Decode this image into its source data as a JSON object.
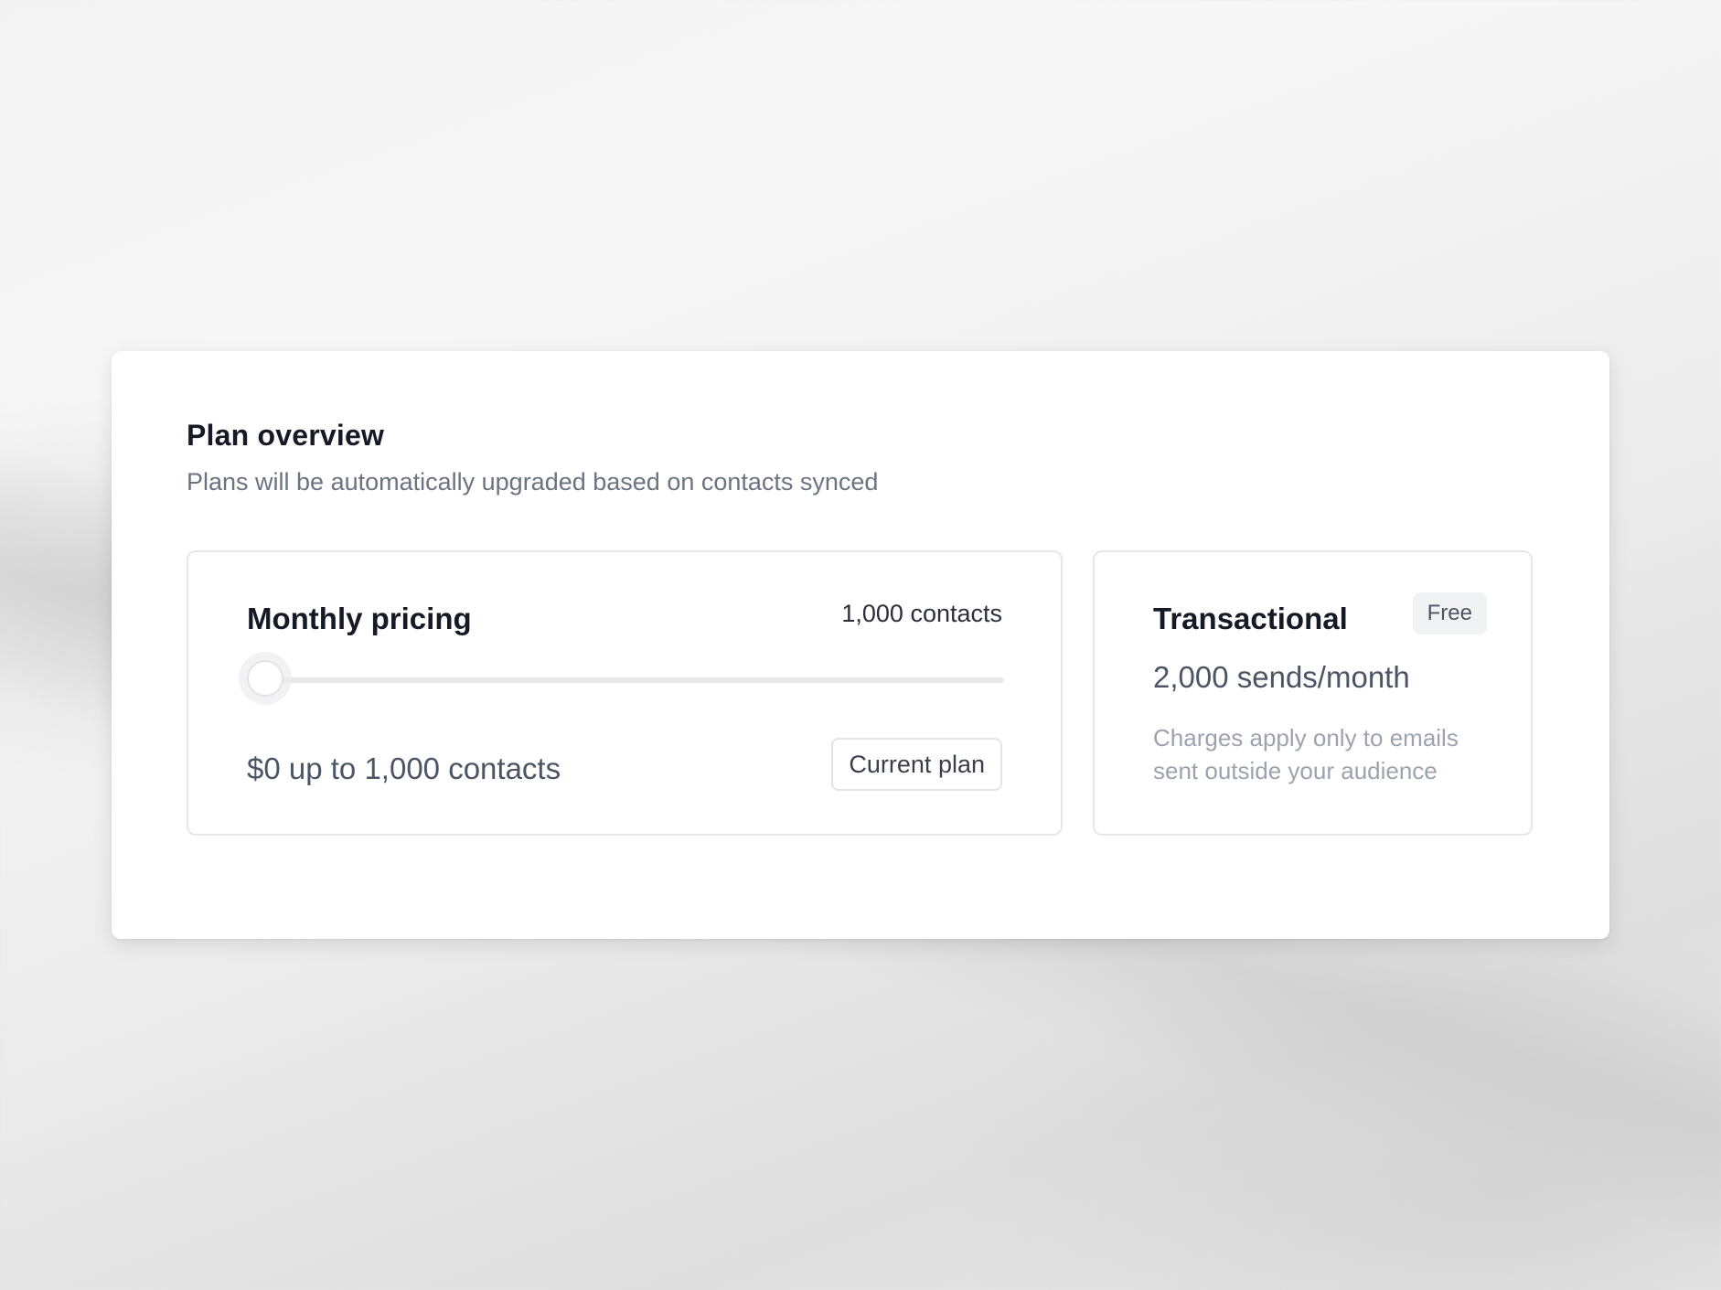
{
  "plan_overview": {
    "title": "Plan overview",
    "subtitle": "Plans will be automatically upgraded based on contacts synced"
  },
  "monthly_pricing": {
    "title": "Monthly pricing",
    "contacts_label": "1,000 contacts",
    "slider": {
      "value_fraction": 0.0
    },
    "price_text": "$0 up to 1,000 contacts",
    "current_plan_button": "Current plan"
  },
  "transactional": {
    "title": "Transactional",
    "badge": "Free",
    "sends": "2,000 sends/month",
    "note": "Charges apply only to emails sent outside your audience"
  }
}
